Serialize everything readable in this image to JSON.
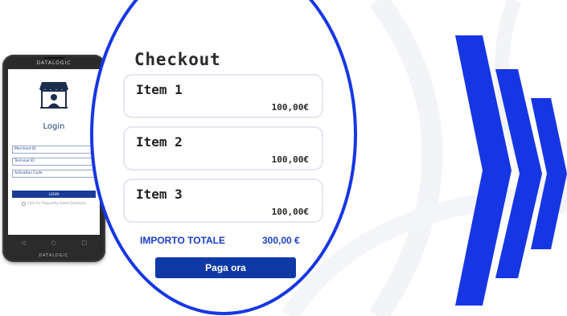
{
  "colors": {
    "accent_blue": "#1736e3",
    "button_blue": "#0f3aa6",
    "total_blue": "#1a3fc7",
    "card_border": "#e3e7f0"
  },
  "phone": {
    "brand_top": "DATALOGIC",
    "brand_bottom": "DATALOGIC",
    "icon": "shop-user-icon",
    "login_title": "Login",
    "fields": [
      {
        "label": "Merchant ID"
      },
      {
        "label": "Terminal ID"
      },
      {
        "label": "Activation Code"
      }
    ],
    "login_button": "LOGIN",
    "faq_link": "Click for Frequently Asked Questions",
    "nav": {
      "back": "◁",
      "home": "○",
      "recent": "□"
    }
  },
  "checkout": {
    "title": "Checkout",
    "items": [
      {
        "name": "Item 1",
        "price": "100,00€"
      },
      {
        "name": "Item 2",
        "price": "100,00€"
      },
      {
        "name": "Item 3",
        "price": "100,00€"
      }
    ],
    "total_label": "IMPORTO TOTALE",
    "total_value": "300,00 €",
    "pay_button": "Paga ora"
  },
  "decor": {
    "chevrons_icon": "triple-chevron-right-icon"
  }
}
